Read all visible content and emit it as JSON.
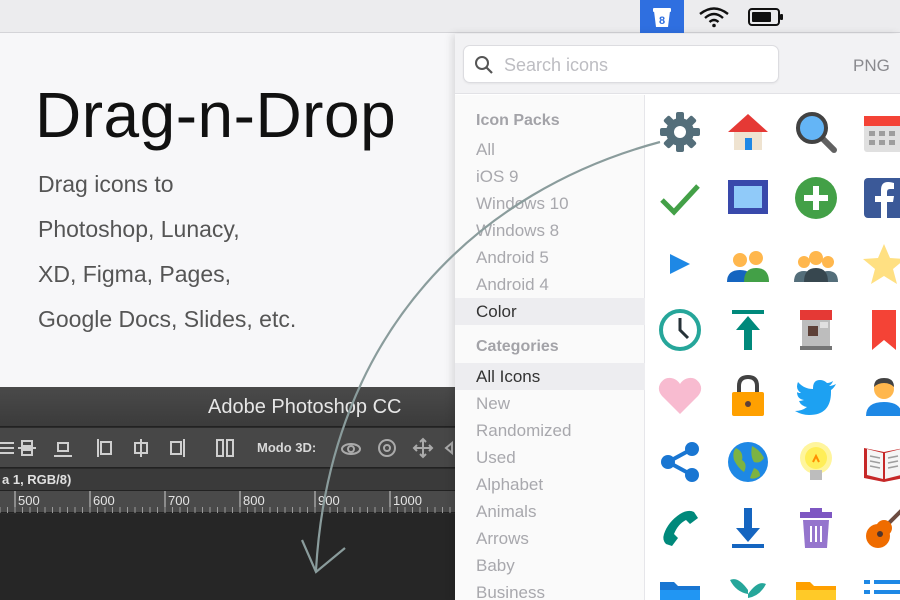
{
  "menubar": {
    "app_icon": "icons8-cup-icon",
    "app_icon_glyph": "8",
    "wifi_icon": "wifi-icon",
    "battery_icon": "battery-icon"
  },
  "promo": {
    "title": "Drag-n-Drop",
    "lines": [
      "Drag icons to",
      "Photoshop, Lunacy,",
      "XD, Figma, Pages,",
      "Google Docs, Slides, etc."
    ]
  },
  "photoshop": {
    "title": "Adobe Photoshop CC",
    "mode_label": "Modo 3D:",
    "doc_tab": "a 1, RGB/8)",
    "ruler": [
      "500",
      "600",
      "700",
      "800",
      "900",
      "1000"
    ]
  },
  "app": {
    "search": {
      "placeholder": "Search icons",
      "value": ""
    },
    "format_label": "PNG",
    "sidebar": {
      "packs_title": "Icon Packs",
      "packs": [
        {
          "label": "All",
          "active": false
        },
        {
          "label": "iOS 9",
          "active": false
        },
        {
          "label": "Windows 10",
          "active": false
        },
        {
          "label": "Windows 8",
          "active": false
        },
        {
          "label": "Android 5",
          "active": false
        },
        {
          "label": "Android 4",
          "active": false
        },
        {
          "label": "Color",
          "active": true
        }
      ],
      "categories_title": "Categories",
      "categories": [
        {
          "label": "All Icons",
          "active": true
        },
        {
          "label": "New",
          "active": false
        },
        {
          "label": "Randomized",
          "active": false
        },
        {
          "label": "Used",
          "active": false
        },
        {
          "label": "Alphabet",
          "active": false
        },
        {
          "label": "Animals",
          "active": false
        },
        {
          "label": "Arrows",
          "active": false
        },
        {
          "label": "Baby",
          "active": false
        },
        {
          "label": "Business",
          "active": false
        }
      ]
    },
    "icons": [
      "settings-icon",
      "home-icon",
      "search-icon",
      "calendar-icon",
      "checkmark-icon",
      "picture-frame-icon",
      "add-icon",
      "facebook-icon",
      "play-icon",
      "user-group-icon",
      "conference-icon",
      "star-icon",
      "clock-icon",
      "upload-icon",
      "coffee-machine-icon",
      "bookmark-icon",
      "heart-icon",
      "lock-icon",
      "twitter-icon",
      "user-icon",
      "share-icon",
      "globe-icon",
      "idea-icon",
      "book-icon",
      "phone-icon",
      "download-icon",
      "trash-icon",
      "guitar-icon",
      "folder-icon",
      "plant-icon",
      "folder-open-icon",
      "list-icon"
    ]
  },
  "colors": {
    "menubar_accent": "#2f6fe0",
    "sidebar_text": "#a8a8ad",
    "sidebar_active_bg": "#ededf0",
    "ps_bg": "#2b2b2b",
    "drag_arrow": "#8a9c9c"
  }
}
